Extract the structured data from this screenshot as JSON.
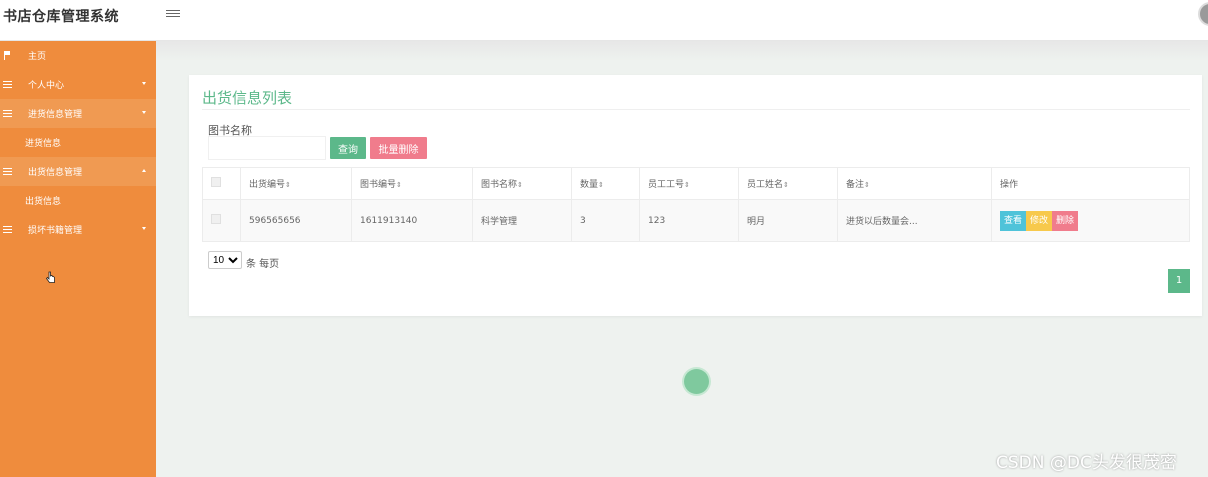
{
  "app": {
    "title": "书店仓库管理系统"
  },
  "sidebar": {
    "items": [
      {
        "label": "主页",
        "icon": "flag-icon"
      },
      {
        "label": "个人中心",
        "icon": "grid-icon"
      },
      {
        "label": "进货信息管理",
        "icon": "grid-icon",
        "open": true
      },
      {
        "label": "进货信息",
        "sub": true
      },
      {
        "label": "出货信息管理",
        "icon": "grid-icon",
        "open": true
      },
      {
        "label": "出货信息",
        "sub": true
      },
      {
        "label": "损坏书籍管理",
        "icon": "grid-icon"
      }
    ]
  },
  "main": {
    "title": "出货信息列表",
    "search": {
      "label": "图书名称",
      "value": "",
      "placeholder": ""
    },
    "buttons": {
      "query": "查询",
      "batch_delete": "批量删除"
    },
    "table": {
      "headers": [
        "出货编号",
        "图书编号",
        "图书名称",
        "数量",
        "员工工号",
        "员工姓名",
        "备注",
        "操作"
      ],
      "rows": [
        {
          "cells": [
            "596565656",
            "1611913140",
            "科学管理",
            "3",
            "123",
            "明月",
            "进货以后数量会..."
          ]
        }
      ],
      "actions": {
        "view": "查看",
        "edit": "修改",
        "delete": "删除"
      }
    },
    "pagination": {
      "page_size": "10",
      "per_page_text": "条 每页",
      "current_page": "1"
    }
  },
  "watermark": "CSDN @DC头发很茂密",
  "colors": {
    "sidebar": "#ef8c3d",
    "accent": "#5cb88a",
    "danger": "#f07c8c",
    "info": "#4fc3d9",
    "warning": "#f7c94c"
  }
}
